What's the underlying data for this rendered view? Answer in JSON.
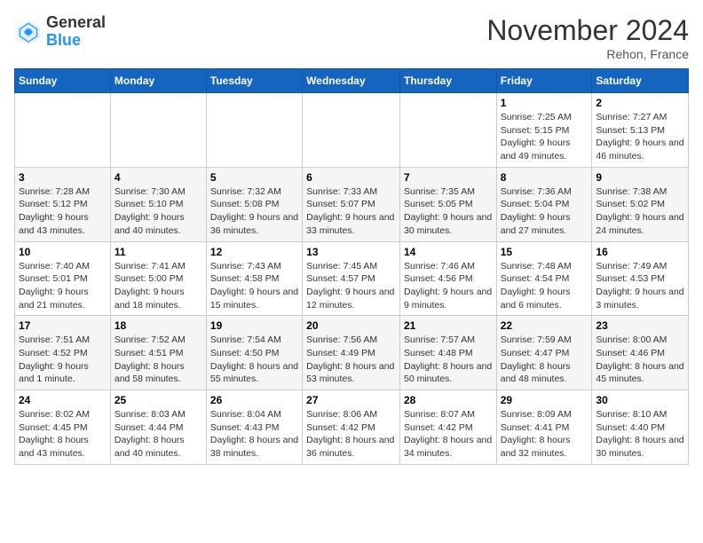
{
  "header": {
    "logo_general": "General",
    "logo_blue": "Blue",
    "month_title": "November 2024",
    "location": "Rehon, France"
  },
  "days_of_week": [
    "Sunday",
    "Monday",
    "Tuesday",
    "Wednesday",
    "Thursday",
    "Friday",
    "Saturday"
  ],
  "weeks": [
    [
      {
        "day": "",
        "info": ""
      },
      {
        "day": "",
        "info": ""
      },
      {
        "day": "",
        "info": ""
      },
      {
        "day": "",
        "info": ""
      },
      {
        "day": "",
        "info": ""
      },
      {
        "day": "1",
        "info": "Sunrise: 7:25 AM\nSunset: 5:15 PM\nDaylight: 9 hours and 49 minutes."
      },
      {
        "day": "2",
        "info": "Sunrise: 7:27 AM\nSunset: 5:13 PM\nDaylight: 9 hours and 46 minutes."
      }
    ],
    [
      {
        "day": "3",
        "info": "Sunrise: 7:28 AM\nSunset: 5:12 PM\nDaylight: 9 hours and 43 minutes."
      },
      {
        "day": "4",
        "info": "Sunrise: 7:30 AM\nSunset: 5:10 PM\nDaylight: 9 hours and 40 minutes."
      },
      {
        "day": "5",
        "info": "Sunrise: 7:32 AM\nSunset: 5:08 PM\nDaylight: 9 hours and 36 minutes."
      },
      {
        "day": "6",
        "info": "Sunrise: 7:33 AM\nSunset: 5:07 PM\nDaylight: 9 hours and 33 minutes."
      },
      {
        "day": "7",
        "info": "Sunrise: 7:35 AM\nSunset: 5:05 PM\nDaylight: 9 hours and 30 minutes."
      },
      {
        "day": "8",
        "info": "Sunrise: 7:36 AM\nSunset: 5:04 PM\nDaylight: 9 hours and 27 minutes."
      },
      {
        "day": "9",
        "info": "Sunrise: 7:38 AM\nSunset: 5:02 PM\nDaylight: 9 hours and 24 minutes."
      }
    ],
    [
      {
        "day": "10",
        "info": "Sunrise: 7:40 AM\nSunset: 5:01 PM\nDaylight: 9 hours and 21 minutes."
      },
      {
        "day": "11",
        "info": "Sunrise: 7:41 AM\nSunset: 5:00 PM\nDaylight: 9 hours and 18 minutes."
      },
      {
        "day": "12",
        "info": "Sunrise: 7:43 AM\nSunset: 4:58 PM\nDaylight: 9 hours and 15 minutes."
      },
      {
        "day": "13",
        "info": "Sunrise: 7:45 AM\nSunset: 4:57 PM\nDaylight: 9 hours and 12 minutes."
      },
      {
        "day": "14",
        "info": "Sunrise: 7:46 AM\nSunset: 4:56 PM\nDaylight: 9 hours and 9 minutes."
      },
      {
        "day": "15",
        "info": "Sunrise: 7:48 AM\nSunset: 4:54 PM\nDaylight: 9 hours and 6 minutes."
      },
      {
        "day": "16",
        "info": "Sunrise: 7:49 AM\nSunset: 4:53 PM\nDaylight: 9 hours and 3 minutes."
      }
    ],
    [
      {
        "day": "17",
        "info": "Sunrise: 7:51 AM\nSunset: 4:52 PM\nDaylight: 9 hours and 1 minute."
      },
      {
        "day": "18",
        "info": "Sunrise: 7:52 AM\nSunset: 4:51 PM\nDaylight: 8 hours and 58 minutes."
      },
      {
        "day": "19",
        "info": "Sunrise: 7:54 AM\nSunset: 4:50 PM\nDaylight: 8 hours and 55 minutes."
      },
      {
        "day": "20",
        "info": "Sunrise: 7:56 AM\nSunset: 4:49 PM\nDaylight: 8 hours and 53 minutes."
      },
      {
        "day": "21",
        "info": "Sunrise: 7:57 AM\nSunset: 4:48 PM\nDaylight: 8 hours and 50 minutes."
      },
      {
        "day": "22",
        "info": "Sunrise: 7:59 AM\nSunset: 4:47 PM\nDaylight: 8 hours and 48 minutes."
      },
      {
        "day": "23",
        "info": "Sunrise: 8:00 AM\nSunset: 4:46 PM\nDaylight: 8 hours and 45 minutes."
      }
    ],
    [
      {
        "day": "24",
        "info": "Sunrise: 8:02 AM\nSunset: 4:45 PM\nDaylight: 8 hours and 43 minutes."
      },
      {
        "day": "25",
        "info": "Sunrise: 8:03 AM\nSunset: 4:44 PM\nDaylight: 8 hours and 40 minutes."
      },
      {
        "day": "26",
        "info": "Sunrise: 8:04 AM\nSunset: 4:43 PM\nDaylight: 8 hours and 38 minutes."
      },
      {
        "day": "27",
        "info": "Sunrise: 8:06 AM\nSunset: 4:42 PM\nDaylight: 8 hours and 36 minutes."
      },
      {
        "day": "28",
        "info": "Sunrise: 8:07 AM\nSunset: 4:42 PM\nDaylight: 8 hours and 34 minutes."
      },
      {
        "day": "29",
        "info": "Sunrise: 8:09 AM\nSunset: 4:41 PM\nDaylight: 8 hours and 32 minutes."
      },
      {
        "day": "30",
        "info": "Sunrise: 8:10 AM\nSunset: 4:40 PM\nDaylight: 8 hours and 30 minutes."
      }
    ]
  ]
}
